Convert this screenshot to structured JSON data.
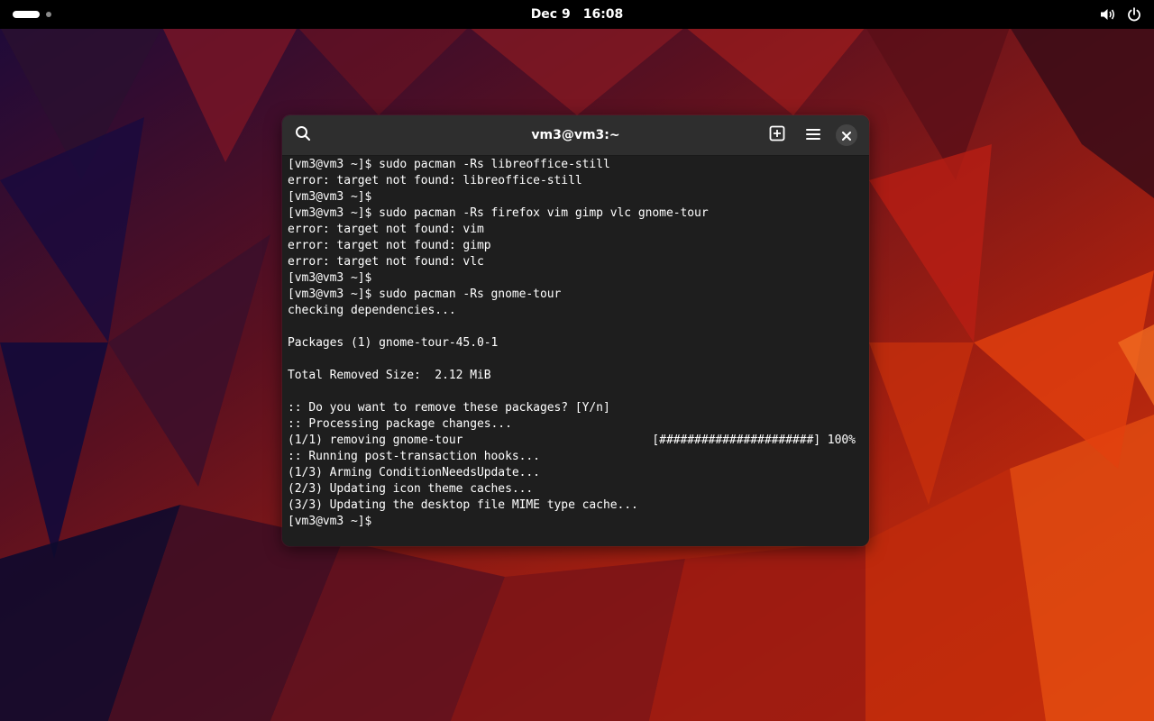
{
  "topbar": {
    "date": "Dec 9",
    "time": "16:08",
    "icons": [
      "workspace-indicator-icon",
      "volume-icon",
      "power-icon"
    ]
  },
  "terminal": {
    "title": "vm3@vm3:~",
    "header_icons": [
      "search-icon",
      "new-tab-icon",
      "hamburger-menu-icon",
      "close-icon"
    ],
    "lines": [
      "[vm3@vm3 ~]$ sudo pacman -Rs libreoffice-still",
      "error: target not found: libreoffice-still",
      "[vm3@vm3 ~]$",
      "[vm3@vm3 ~]$ sudo pacman -Rs firefox vim gimp vlc gnome-tour",
      "error: target not found: vim",
      "error: target not found: gimp",
      "error: target not found: vlc",
      "[vm3@vm3 ~]$",
      "[vm3@vm3 ~]$ sudo pacman -Rs gnome-tour",
      "checking dependencies...",
      "",
      "Packages (1) gnome-tour-45.0-1",
      "",
      "Total Removed Size:  2.12 MiB",
      "",
      ":: Do you want to remove these packages? [Y/n]",
      ":: Processing package changes...",
      "(1/1) removing gnome-tour                           [######################] 100%",
      ":: Running post-transaction hooks...",
      "(1/3) Arming ConditionNeedsUpdate...",
      "(2/3) Updating icon theme caches...",
      "(3/3) Updating the desktop file MIME type cache...",
      "[vm3@vm3 ~]$"
    ]
  },
  "colors": {
    "topbar_bg": "#000000",
    "terminal_bg": "#1e1e1e",
    "headerbar_bg": "#2e2e2e",
    "terminal_fg": "#ffffff"
  }
}
